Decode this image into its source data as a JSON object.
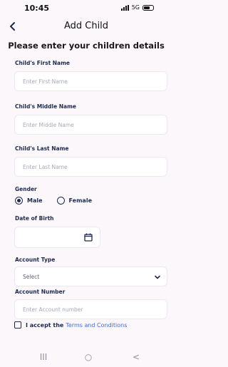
{
  "status_bar": {
    "time": "10:45",
    "network": "5G"
  },
  "header": {
    "back_icon": "back-chevron-icon",
    "title": "Add Child"
  },
  "intro": "Please enter your children details",
  "fields": {
    "first_name": {
      "label": "Child's First Name",
      "placeholder": "Enter First Name"
    },
    "middle_name": {
      "label": "Child's Middle Name",
      "placeholder": "Enter Middle Name"
    },
    "last_name": {
      "label": "Child's Last Name",
      "placeholder": "Enter Last Name"
    },
    "gender": {
      "label": "Gender",
      "options": [
        "Male",
        "Female"
      ],
      "selected": "Male"
    },
    "dob": {
      "label": "Date of Birth",
      "icon": "calendar-icon"
    },
    "account_type": {
      "label": "Account Type",
      "value": "Select",
      "icon": "chevron-down-icon"
    },
    "account_number": {
      "label": "Account Number",
      "placeholder": "Enter Account number"
    }
  },
  "terms": {
    "prefix": "I accept the",
    "link": "Terms and Conditions"
  },
  "navbar": {
    "recents": "III",
    "home": "○",
    "back": "<"
  }
}
